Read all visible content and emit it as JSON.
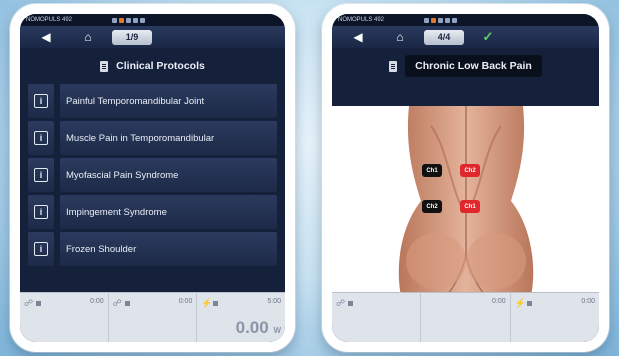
{
  "left": {
    "status_text": "NOMOPULS 492",
    "page": "1/9",
    "heading": "Clinical Protocols",
    "protocols": [
      "Painful Temporomandibular Joint",
      "Muscle Pain in Temporomandibular",
      "Myofascial Pain Syndrome",
      "Impingement Syndrome",
      "Frozen Shoulder"
    ],
    "bottom": {
      "time1": "0:00",
      "time2": "0:00",
      "time3": "5:00",
      "big_value": "0.00",
      "big_unit": "W"
    }
  },
  "right": {
    "status_text": "NOMOPULS 492",
    "page": "4/4",
    "heading": "Chronic Low Back Pain",
    "electrodes": [
      "Ch1",
      "Ch2",
      "Ch2",
      "Ch1"
    ],
    "bottom": {
      "time1": "0:00",
      "time2": "0:00"
    }
  },
  "icons": {
    "back": "back-arrow-icon",
    "home": "home-icon",
    "check": "check-icon",
    "info": "info-icon",
    "document": "document-icon"
  },
  "colors": {
    "screen_bg": "#15203a",
    "accent_orange": "#e1772b",
    "electrode_red": "#e0282c",
    "check_green": "#5fd05a"
  }
}
